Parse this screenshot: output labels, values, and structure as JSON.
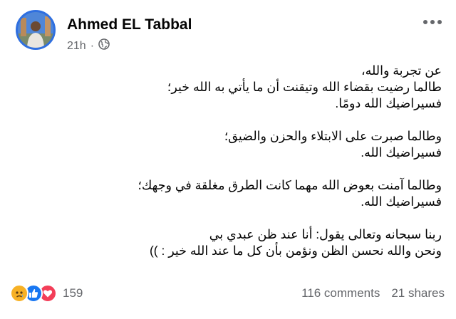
{
  "post": {
    "author": "Ahmed EL Tabbal",
    "time": "21h",
    "dot": "·",
    "paragraphs": [
      [
        "عن تجربة والله،",
        "طالما رضيت بقضاء الله وتيقنت أن ما يأتي به الله خير؛",
        "فسيراضيك الله دومًا."
      ],
      [
        "وطالما صبرت على الابتلاء والحزن والضيق؛",
        "فسيراضيك الله."
      ],
      [
        "وطالما آمنت بعوض الله مهما كانت الطرق مغلقة في وجهك؛",
        "فسيراضيك الله."
      ],
      [
        "ربنا سبحانه وتعالى يقول: أنا عند ظن عبدي بي",
        "ونحن والله نحسن الظن ونؤمن بأن كل ما عند الله خير : ))"
      ]
    ]
  },
  "footer": {
    "reactions_count": "159",
    "reactions": [
      "sad",
      "like",
      "love"
    ],
    "comments": "116 comments",
    "shares": "21 shares"
  },
  "colors": {
    "like": "#1877f2",
    "love": "#f33e58",
    "sad": "#f7b125",
    "secondary_text": "#65676b",
    "avatar_ring": "#2f6fe0"
  },
  "icons": {
    "audience": "globe-icon",
    "menu": "more-options-icon"
  }
}
